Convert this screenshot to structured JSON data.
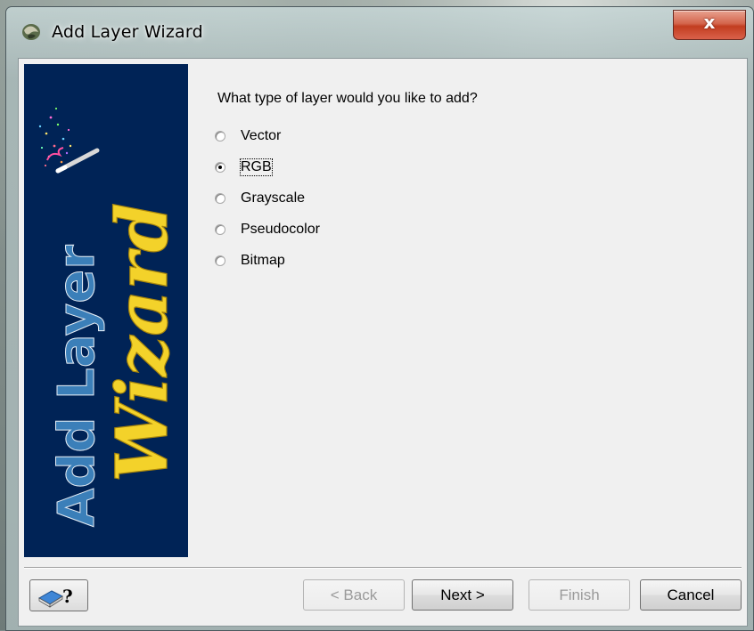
{
  "window": {
    "title": "Add Layer Wizard",
    "close_glyph": "x"
  },
  "banner": {
    "line1": "Add Layer",
    "line2": "Wizard",
    "colors": {
      "background": "#002356",
      "line1": "#3b7fb9",
      "line2": "#f3d22a"
    },
    "icon": "magic-wand-icon"
  },
  "main": {
    "question": "What type of layer would you like to add?",
    "options": [
      {
        "label": "Vector",
        "checked": false
      },
      {
        "label": "RGB",
        "checked": true
      },
      {
        "label": "Grayscale",
        "checked": false
      },
      {
        "label": "Pseudocolor",
        "checked": false
      },
      {
        "label": "Bitmap",
        "checked": false
      }
    ]
  },
  "buttons": {
    "help_icon": "book-help-icon",
    "help_glyph": "?",
    "back": "< Back",
    "next": "Next >",
    "finish": "Finish",
    "cancel": "Cancel"
  }
}
